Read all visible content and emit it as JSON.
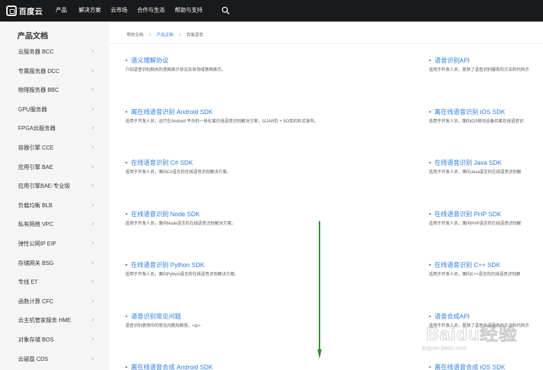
{
  "header": {
    "logo_text": "百度云",
    "nav": [
      "产品",
      "解决方案",
      "云市场",
      "合作与生态",
      "帮助与支持"
    ]
  },
  "sidebar": {
    "title": "产品文档",
    "items": [
      {
        "label": "云服务器 BCC"
      },
      {
        "label": "专属服务器 DCC"
      },
      {
        "label": "物理服务器 BBC"
      },
      {
        "label": "GPU服务器"
      },
      {
        "label": "FPGA云服务器"
      },
      {
        "label": "容器引擎 CCE"
      },
      {
        "label": "应用引擎 BAE"
      },
      {
        "label": "应用引擎BAE-专业版"
      },
      {
        "label": "负载均衡 BLB"
      },
      {
        "label": "私有网络 VPC"
      },
      {
        "label": "弹性公网IP EIP"
      },
      {
        "label": "存储网关 BSG"
      },
      {
        "label": "专线 ET"
      },
      {
        "label": "函数计算 CFC"
      },
      {
        "label": "云主机管家服务 HME"
      },
      {
        "label": "对象存储 BOS"
      },
      {
        "label": "云磁盘 CDS"
      }
    ],
    "chevron": "›"
  },
  "breadcrumb": {
    "items": [
      "帮助文档",
      "产品文档"
    ],
    "current": "百度语音",
    "separator": ">"
  },
  "docs_left": [
    {
      "title": "语义理解协议",
      "desc": "介绍语音识别相关的意图表示协议及各领域意图表示。"
    },
    {
      "title": "离在线语音识别 Android SDK",
      "desc": "适用于开发人员，运行在Android 平台的一体化离在线语音识别解决方案，以JAR包 + SO库的形式发布。"
    },
    {
      "title": "在线语音识别 C# SDK",
      "desc": "适用于开发人员，面向C#语言的在线语音识别解决方案。"
    },
    {
      "title": "在线语音识别 Node SDK",
      "desc": "适用于开发人员，面向Node语言的在线语音识别解决方案。"
    },
    {
      "title": "在线语音识别 Python SDK",
      "desc": "适用于开发人员，面向Python语言的在线语音识别解决方案。"
    },
    {
      "title": "语音识别常见问题",
      "desc": "语音识别使用中的常见问题及解答。</p>"
    },
    {
      "title": "离在线语音合成 Android SDK",
      "desc": ""
    }
  ],
  "docs_right": [
    {
      "title": "语音识别API",
      "desc": "适用于开发人员，提供了语音识别服务的方法和代码示"
    },
    {
      "title": "离在线语音识别 iOS SDK",
      "desc": "适用于开发人员，面向iOS移动设备的离在线语音识"
    },
    {
      "title": "在线语音识别 Java SDK",
      "desc": "适用于开发人员，面向Java语言的在线语音识别解"
    },
    {
      "title": "在线语音识别 PHP SDK",
      "desc": "适用于开发人员，面向PHP语言的在线语音识别解"
    },
    {
      "title": "在线语音识别 C++ SDK",
      "desc": "适用于开发人员，面向C++语言的在线语音识别解"
    },
    {
      "title": "语音合成API",
      "desc": "适用于开发人员，提供了语音合成服务的方法和代码示"
    },
    {
      "title": "离在线语音合成 iOS SDK",
      "desc": ""
    }
  ],
  "watermark": {
    "text": "Baidu经验",
    "url": "jingyan.baidu.com"
  },
  "colors": {
    "topbar": "#191a1c",
    "link": "#2a7de1",
    "sidebar_bg": "#f5f5f5",
    "arrow": "#2e8b2e"
  }
}
